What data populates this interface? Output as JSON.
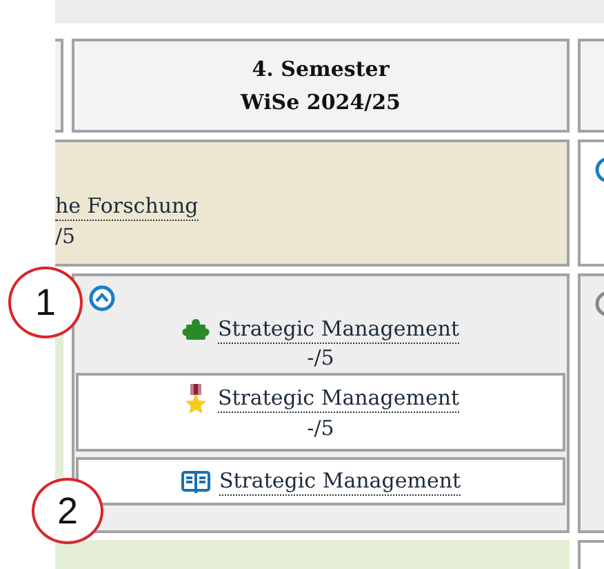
{
  "semester_header": {
    "line_1": "4. Semester",
    "line_2": "WiSe 2024/25"
  },
  "upper_module": {
    "title": "he Forschung",
    "grade": "/5"
  },
  "module_group": {
    "expanded": true,
    "title": "Strategic Management",
    "grade": "-/5",
    "items": [
      {
        "kind": "exam",
        "title": "Strategic Management",
        "grade": "-/5"
      },
      {
        "kind": "course",
        "title": "Strategic Management"
      }
    ]
  },
  "callouts": [
    "1",
    "2"
  ]
}
